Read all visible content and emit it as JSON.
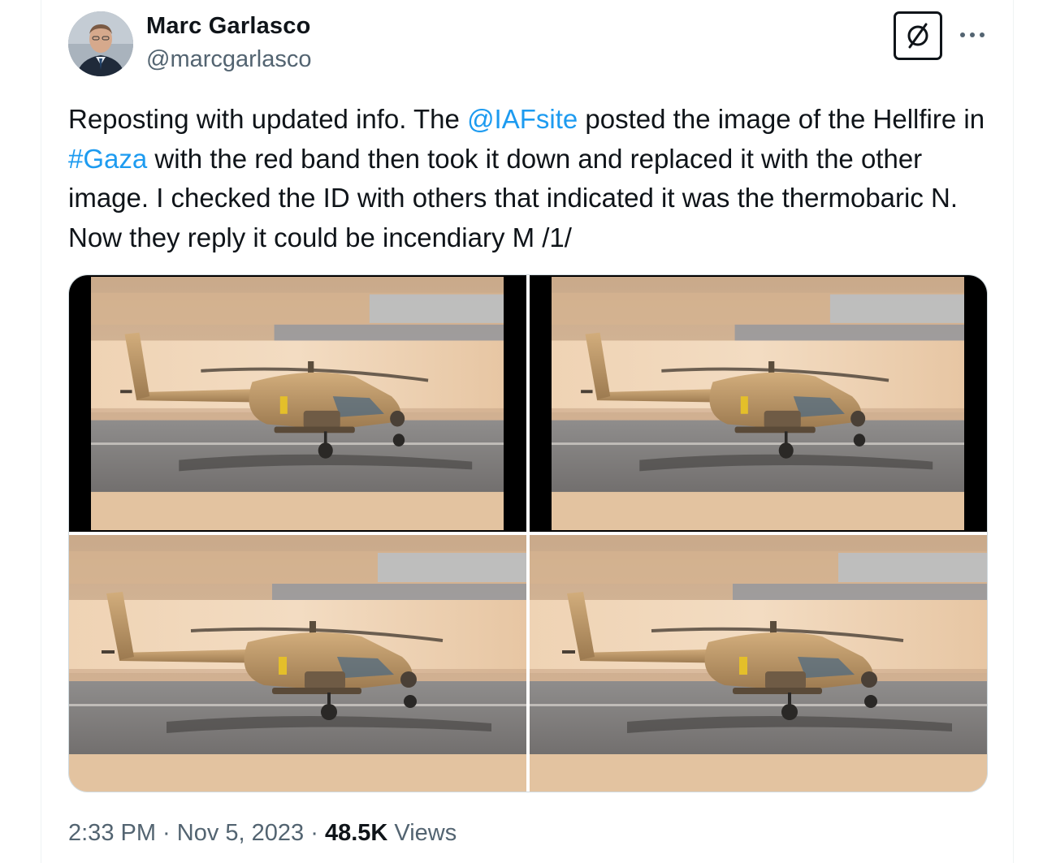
{
  "tweet": {
    "author": {
      "name": "Marc Garlasco",
      "handle": "@marcgarlasco"
    },
    "text": {
      "part1": "Reposting with updated info. The ",
      "mention": "@IAFsite",
      "part2": " posted the image of the Hellfire in ",
      "hashtag": "#Gaza",
      "part3": " with the red band then took it down and replaced it with the other image. I checked the ID with others that indicated it was the thermobaric N. Now they reply it could be incendiary M /1/"
    },
    "media": {
      "count": 4,
      "description_icons": [
        "helicopter-photo-1",
        "helicopter-photo-2",
        "helicopter-photo-3",
        "helicopter-photo-4"
      ]
    },
    "meta": {
      "time": "2:33 PM",
      "sep1": " · ",
      "date": "Nov 5, 2023",
      "sep2": " · ",
      "views_count": "48.5K",
      "views_label": " Views"
    }
  },
  "icons": {
    "grok": "grok-icon",
    "more": "more-icon"
  },
  "colors": {
    "link": "#1d9bf0",
    "secondary_text": "#536471",
    "primary_text": "#0f1419"
  }
}
